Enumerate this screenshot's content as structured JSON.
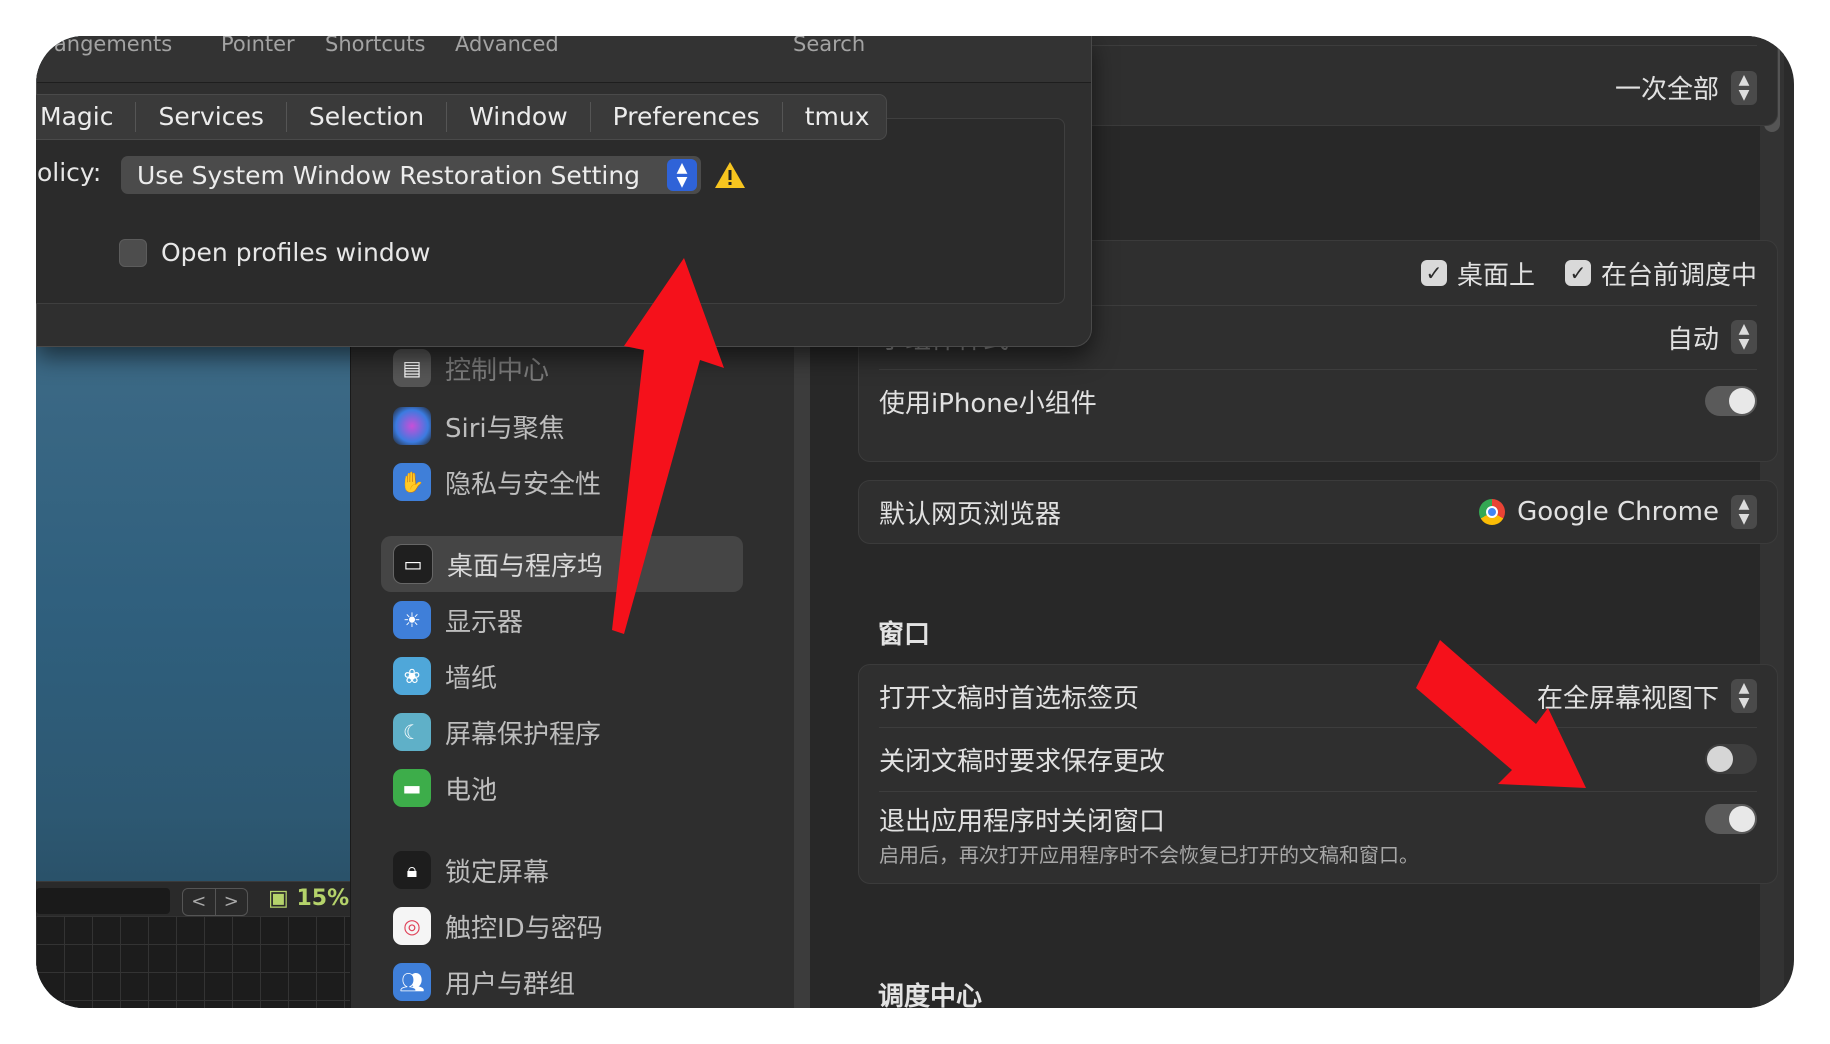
{
  "dialog": {
    "tabs": [
      "rrangements",
      "Pointer",
      "Shortcuts",
      "Advanced",
      "Search"
    ],
    "segments": [
      "Magic",
      "Services",
      "Selection",
      "Window",
      "Preferences",
      "tmux"
    ],
    "policy_label": "olicy:",
    "policy_value": "Use System Window Restoration Setting",
    "open_profiles_label": "Open profiles window"
  },
  "terminal": {
    "nav_prev": "<",
    "nav_next": ">",
    "cpu": "15%"
  },
  "sidebar": {
    "items": [
      {
        "label": "控制中心",
        "icon": "control-center-icon"
      },
      {
        "label": "Siri与聚焦",
        "icon": "siri-icon"
      },
      {
        "label": "隐私与安全性",
        "icon": "hand-icon"
      },
      {
        "label": "桌面与程序坞",
        "icon": "dock-icon"
      },
      {
        "label": "显示器",
        "icon": "brightness-icon"
      },
      {
        "label": "墙纸",
        "icon": "wallpaper-icon"
      },
      {
        "label": "屏幕保护程序",
        "icon": "screensaver-icon"
      },
      {
        "label": "电池",
        "icon": "battery-icon"
      },
      {
        "label": "锁定屏幕",
        "icon": "lock-icon"
      },
      {
        "label": "触控ID与密码",
        "icon": "fingerprint-icon"
      },
      {
        "label": "用户与群组",
        "icon": "users-icon"
      }
    ]
  },
  "main": {
    "top_popup": "一次全部",
    "widgets": {
      "check_desktop": "桌面上",
      "check_stage": "在台前调度中",
      "widget_style_label": "小组件样式",
      "widget_style_value": "自动",
      "iphone_widgets_label": "使用iPhone小组件"
    },
    "browser": {
      "label": "默认网页浏览器",
      "value": "Google Chrome"
    },
    "window_section": {
      "title": "窗口",
      "tabs_pref_label": "打开文稿时首选标签页",
      "tabs_pref_value": "在全屏幕视图下",
      "ask_save_label": "关闭文稿时要求保存更改",
      "close_windows_label": "退出应用程序时关闭窗口",
      "close_windows_desc": "启用后，再次打开应用程序时不会恢复已打开的文稿和窗口。"
    },
    "mission_control_title": "调度中心"
  },
  "colors": {
    "arrow": "#f5111b",
    "selected_popup": "#2f63d8",
    "warning": "#f7c51f"
  }
}
